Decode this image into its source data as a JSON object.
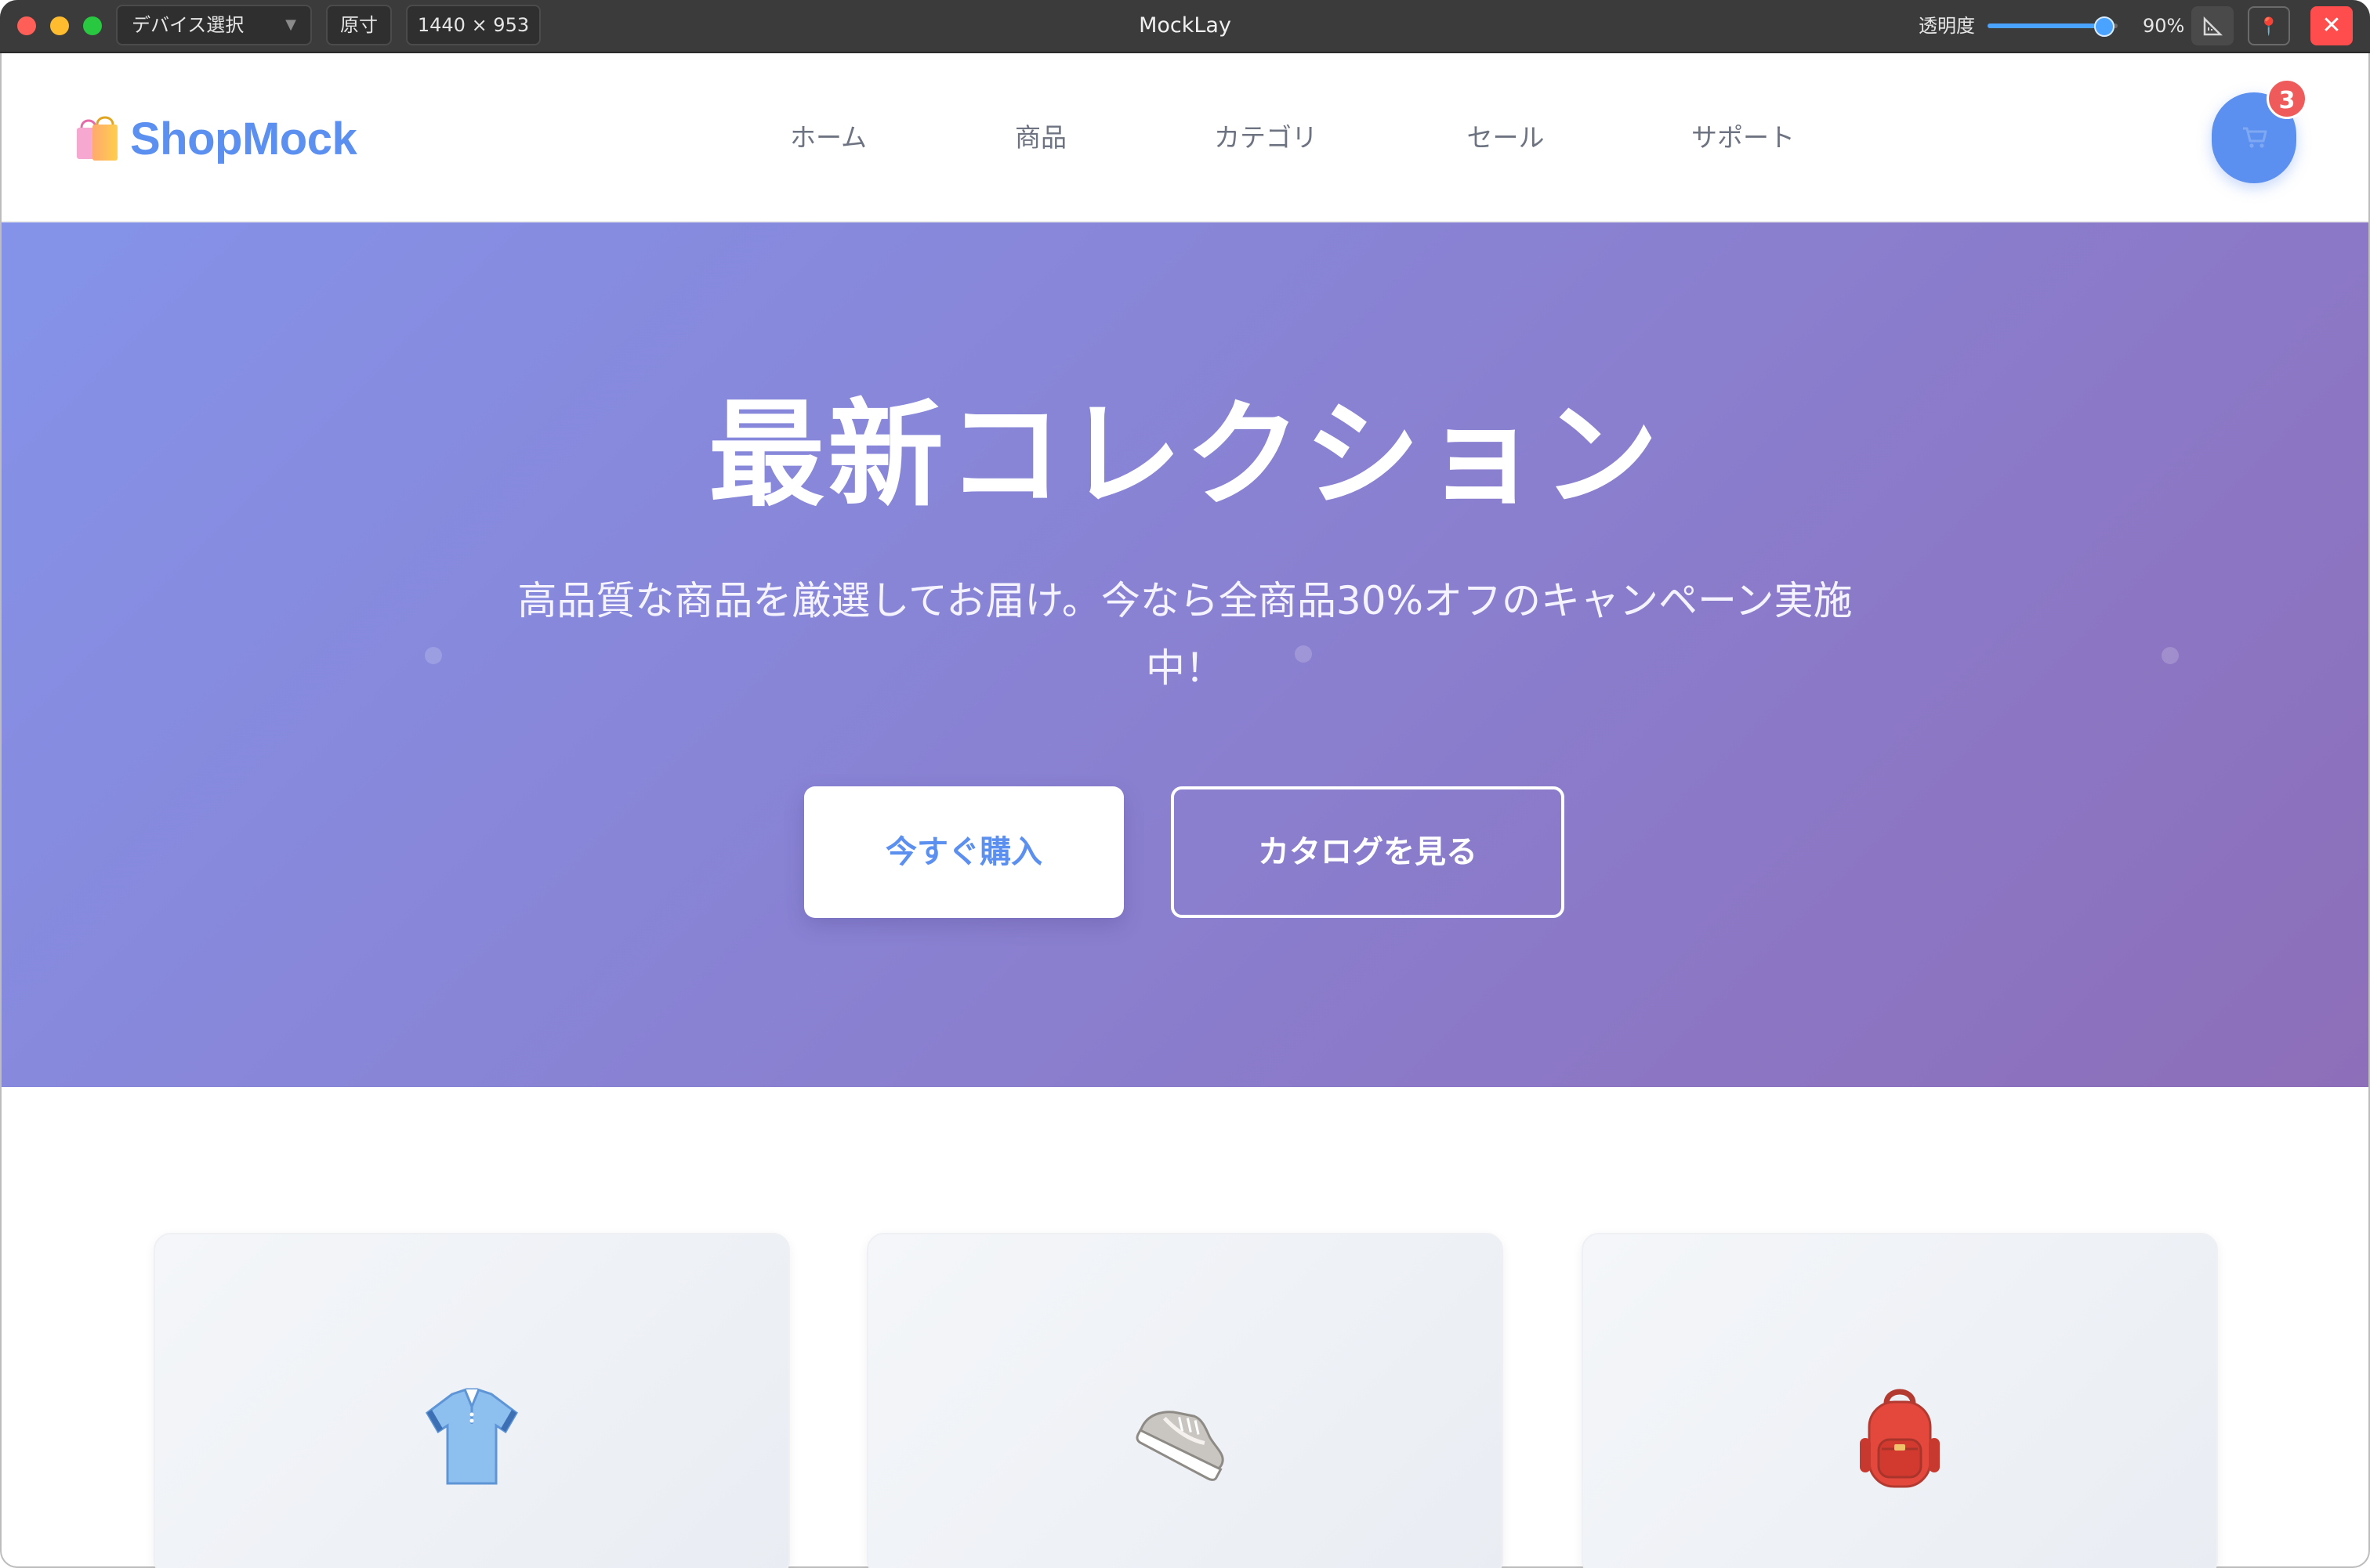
{
  "app": {
    "title": "MockLay",
    "device_select": "デバイス選択",
    "original_size_label": "原寸",
    "size_readout": "1440 × 953",
    "opacity_label": "透明度",
    "opacity_value": "90%",
    "opacity_fraction": 0.9
  },
  "site": {
    "logo_text": "ShopMock",
    "nav": [
      "ホーム",
      "商品",
      "カテゴリ",
      "セール",
      "サポート"
    ],
    "cart_badge": "3",
    "hero": {
      "title": "最新コレクション",
      "subtitle_line1": "高品質な商品を厳選してお届け。今なら全商品30%オフのキャンペーン実施",
      "subtitle_line2": "中！",
      "primary_cta": "今すぐ購入",
      "secondary_cta": "カタログを見る"
    },
    "products": [
      {
        "icon": "polo-shirt-icon"
      },
      {
        "icon": "sneaker-icon"
      },
      {
        "icon": "backpack-icon"
      }
    ]
  },
  "colors": {
    "brand": "#5b8ff0",
    "badge": "#ef5b5b",
    "hero_start": "#8493e9",
    "hero_end": "#8d6eb9"
  }
}
